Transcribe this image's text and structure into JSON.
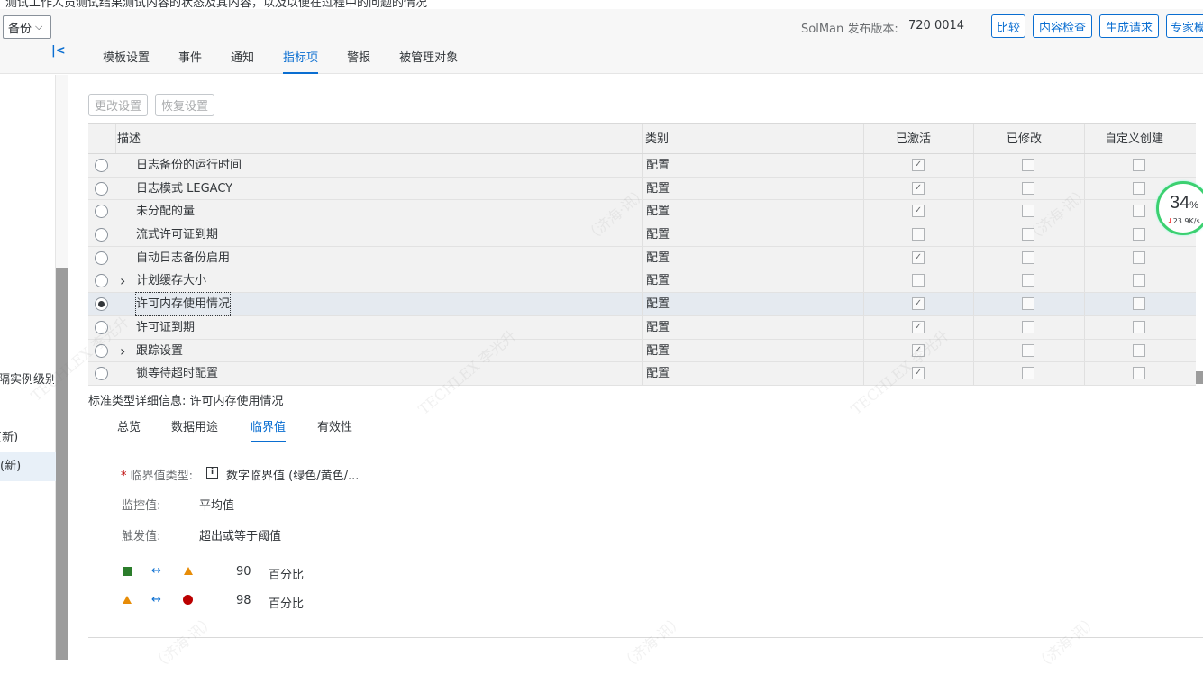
{
  "top_strip": {
    "text": "测试工作人员测试结果测试内容的状态及其内容，以及以便在过程中的问题的情况"
  },
  "header": {
    "backup_select": "备份",
    "version_label": "SolMan 发布版本:",
    "version_value": "720 0014",
    "buttons": {
      "compare": "比较",
      "content_check": "内容检查",
      "generate_request": "生成请求",
      "expert": "专家模"
    },
    "tabs": [
      "模板设置",
      "事件",
      "通知",
      "指标项",
      "警报",
      "被管理对象"
    ],
    "active_tab": "指标项"
  },
  "sidebar": {
    "items": [
      "隔实例级别",
      "(新)",
      "(新)"
    ]
  },
  "toolbar": {
    "change_settings": "更改设置",
    "restore_settings": "恢复设置"
  },
  "table": {
    "columns": {
      "description": "描述",
      "category": "类别",
      "active": "已激活",
      "modified": "已修改",
      "custom": "自定义创建"
    },
    "rows": [
      {
        "desc": "日志备份的运行时间",
        "cat": "配置",
        "active": true,
        "expand": false,
        "selected": false
      },
      {
        "desc": "日志模式 LEGACY",
        "cat": "配置",
        "active": true,
        "expand": false,
        "selected": false
      },
      {
        "desc": "未分配的量",
        "cat": "配置",
        "active": true,
        "expand": false,
        "selected": false
      },
      {
        "desc": "流式许可证到期",
        "cat": "配置",
        "active": false,
        "expand": false,
        "selected": false
      },
      {
        "desc": "自动日志备份启用",
        "cat": "配置",
        "active": true,
        "expand": false,
        "selected": false
      },
      {
        "desc": "计划缓存大小",
        "cat": "配置",
        "active": false,
        "expand": true,
        "selected": false
      },
      {
        "desc": "许可内存使用情况",
        "cat": "配置",
        "active": true,
        "expand": false,
        "selected": true
      },
      {
        "desc": "许可证到期",
        "cat": "配置",
        "active": true,
        "expand": false,
        "selected": false
      },
      {
        "desc": "跟踪设置",
        "cat": "配置",
        "active": true,
        "expand": true,
        "selected": false
      },
      {
        "desc": "锁等待超时配置",
        "cat": "配置",
        "active": true,
        "expand": false,
        "selected": false
      }
    ]
  },
  "details": {
    "title": "标准类型详细信息: 许可内存使用情况",
    "tabs": [
      "总览",
      "数据用途",
      "临界值",
      "有效性"
    ],
    "active_tab": "临界值",
    "threshold_type_label": "临界值类型:",
    "threshold_type_required": "*",
    "threshold_type_value": "数字临界值 (绿色/黄色/...",
    "monitor_label": "监控值:",
    "monitor_value": "平均值",
    "trigger_label": "触发值:",
    "trigger_value": "超出或等于阈值",
    "thresholds": [
      {
        "from": "green",
        "to": "yellow",
        "value": "90",
        "unit": "百分比"
      },
      {
        "from": "yellow",
        "to": "red",
        "value": "98",
        "unit": "百分比"
      }
    ],
    "arrow_glyph": "↔"
  },
  "speed_widget": {
    "percent": "34",
    "percent_sign": "%",
    "rate": "23.9K/s",
    "rate_arrow": "↓"
  },
  "colors": {
    "accent": "#0a6ed1",
    "green": "#2b7d2b",
    "yellow": "#e78c07",
    "red": "#bb0000",
    "ring": "#3cd070"
  }
}
